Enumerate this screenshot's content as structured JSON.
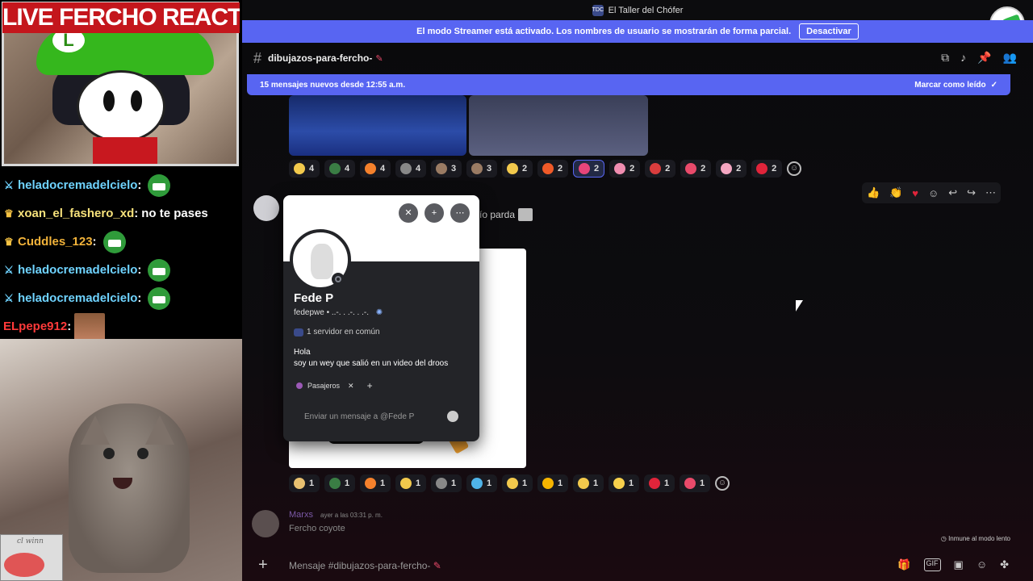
{
  "overlay": {
    "webcam_title": "LIVE FERCHO REACTION",
    "cap_letter": "L",
    "chat": [
      {
        "badge": "sword-icon",
        "user": "heladocremadelcielo",
        "color": "#6fd3ff",
        "text": "",
        "emote": "pepe-emote"
      },
      {
        "badge": "crown-icon",
        "user": "xoan_el_fashero_xd",
        "color": "#f6e17b",
        "text": "no te pases",
        "emote": ""
      },
      {
        "badge": "crown-icon",
        "user": "Cuddles_123",
        "color": "#f2b33a",
        "text": "",
        "emote": "pepe-emote"
      },
      {
        "badge": "sword-icon",
        "user": "heladocremadelcielo",
        "color": "#6fd3ff",
        "text": "",
        "emote": "pepe-emote"
      },
      {
        "badge": "sword-icon",
        "user": "heladocremadelcielo",
        "color": "#6fd3ff",
        "text": "",
        "emote": "pepe-emote"
      },
      {
        "badge": "",
        "user": "ELpepe912",
        "color": "#ff3a3a",
        "text": "",
        "emote": "photo-emote"
      }
    ],
    "mini_cam_text": "cl winn"
  },
  "discord": {
    "window_title": "El Taller del Chófer",
    "streamer_notice": "El modo Streamer está activado. Los nombres de usuario se mostrarán de forma parcial.",
    "streamer_button": "Desactivar",
    "channel_name": "dibujazos-para-fercho-",
    "new_messages_text": "15 mensajes nuevos desde 12:55 a.m.",
    "mark_read": "Marcar como leído",
    "reactions_top": [
      {
        "color": "#f2c94c",
        "count": "4"
      },
      {
        "color": "#3a7d44",
        "count": "4"
      },
      {
        "color": "#f5812c",
        "count": "4"
      },
      {
        "color": "#888888",
        "count": "4"
      },
      {
        "color": "#9a7b63",
        "count": "3"
      },
      {
        "color": "#9a7b63",
        "count": "3"
      },
      {
        "color": "#f2c94c",
        "count": "2"
      },
      {
        "color": "#f05a28",
        "count": "2"
      },
      {
        "color": "#e8457a",
        "count": "2",
        "active": true
      },
      {
        "color": "#f08db0",
        "count": "2"
      },
      {
        "color": "#d93d3d",
        "count": "2"
      },
      {
        "color": "#e84a6a",
        "count": "2"
      },
      {
        "color": "#f4a6c1",
        "count": "2"
      },
      {
        "color": "#e0243a",
        "count": "2"
      }
    ],
    "reactions_bottom": [
      {
        "color": "#e8c070",
        "count": "1"
      },
      {
        "color": "#3a7d44",
        "count": "1"
      },
      {
        "color": "#f5812c",
        "count": "1"
      },
      {
        "color": "#f2c94c",
        "count": "1"
      },
      {
        "color": "#888888",
        "count": "1"
      },
      {
        "color": "#4fb3e8",
        "count": "1"
      },
      {
        "color": "#f2c94c",
        "count": "1"
      },
      {
        "color": "#f7b500",
        "count": "1"
      },
      {
        "color": "#f2c94c",
        "count": "1"
      },
      {
        "color": "#f7d04c",
        "count": "1"
      },
      {
        "color": "#e0243a",
        "count": "1"
      },
      {
        "color": "#e84a6a",
        "count": "1"
      }
    ],
    "message_fragment": "ío parda",
    "popout": {
      "display_name": "Fede P",
      "handle": "fedepwe • ..-. . .-. . .-.",
      "mutual_servers": "1 servidor en común",
      "bio_line1": "Hola",
      "bio_line2": "soy un wey que salió en un video del droos",
      "role": "Pasajeros",
      "message_placeholder": "Enviar un mensaje a @Fede P"
    },
    "last_message": {
      "author": "Marxs",
      "time": "ayer a las 03:31 p. m.",
      "text": "Fercho coyote"
    },
    "slowmode": "Inmune al modo lento",
    "composer_placeholder": "Mensaje #dibujazos-para-fercho-"
  },
  "colors": {
    "blurple": "#5865f2",
    "background": "#0c0c0e",
    "popout_bg": "#232428"
  }
}
